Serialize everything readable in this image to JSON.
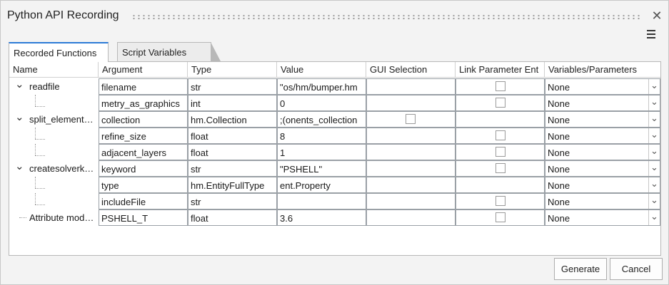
{
  "window": {
    "title": "Python API Recording"
  },
  "tabs": [
    {
      "label": "Recorded Functions",
      "active": true
    },
    {
      "label": "Script Variables",
      "active": false
    }
  ],
  "columns": [
    "Name",
    "Argument",
    "Type",
    "Value",
    "GUI Selection",
    "Link Parameter Ent",
    "Variables/Parameters"
  ],
  "rows": [
    {
      "name": "readfile",
      "expanded": true,
      "argument": "filename",
      "type": "str",
      "value": "os/hm/bumper.hm\"",
      "value_overflow": true,
      "gui_checkbox": false,
      "link_checkbox": true,
      "variable": "None"
    },
    {
      "name": "",
      "argument": "metry_as_graphics",
      "argument_overflow": true,
      "type": "int",
      "value": "0",
      "gui_checkbox": false,
      "link_checkbox": true,
      "variable": "None"
    },
    {
      "name": "split_element…",
      "expanded": true,
      "argument": "collection",
      "type": "hm.Collection",
      "value": "onents_collection);",
      "value_overflow": true,
      "gui_checkbox": true,
      "link_checkbox": false,
      "variable": "None"
    },
    {
      "name": "",
      "argument": "refine_size",
      "type": "float",
      "value": "8",
      "gui_checkbox": false,
      "link_checkbox": true,
      "variable": "None"
    },
    {
      "name": "",
      "argument": "adjacent_layers",
      "type": "float",
      "value": "1",
      "gui_checkbox": false,
      "link_checkbox": true,
      "variable": "None"
    },
    {
      "name": "createsolverk…",
      "expanded": true,
      "argument": "keyword",
      "type": "str",
      "value": "\"PSHELL\"",
      "gui_checkbox": false,
      "link_checkbox": true,
      "variable": "None"
    },
    {
      "name": "",
      "argument": "type",
      "type": "hm.EntityFullType",
      "value": "ent.Property",
      "value_overflow": true,
      "gui_checkbox": false,
      "link_checkbox": false,
      "variable": "None"
    },
    {
      "name": "",
      "argument": "includeFile",
      "type": "str",
      "value": "",
      "gui_checkbox": false,
      "link_checkbox": true,
      "variable": "None"
    },
    {
      "name": "Attribute mod…",
      "expanded": false,
      "argument": "PSHELL_T",
      "type": "float",
      "value": "3.6",
      "gui_checkbox": false,
      "link_checkbox": true,
      "variable": "None"
    }
  ],
  "buttons": {
    "generate": "Generate",
    "cancel": "Cancel"
  },
  "icons": {
    "close": "close-icon",
    "menu": "hamburger-menu-icon",
    "expand": "chevron-down-icon",
    "dropdown": "chevron-down-icon"
  },
  "colors": {
    "tab_accent": "#2d7bd6",
    "background": "#f3f3f3"
  }
}
